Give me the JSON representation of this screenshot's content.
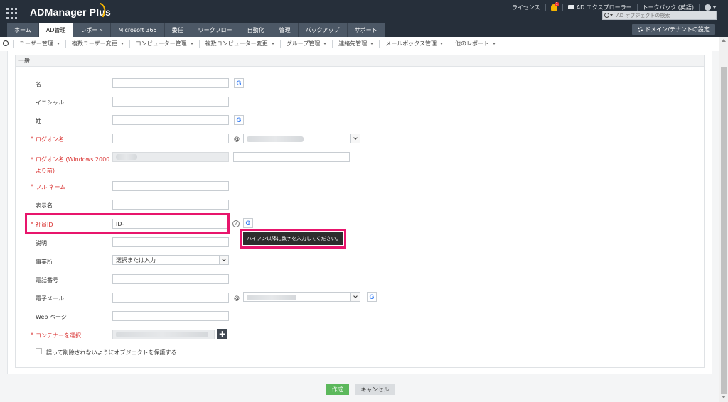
{
  "app": {
    "title": "ADManager Plus"
  },
  "top_links": {
    "license": "ライセンス",
    "notification_count": "1",
    "explorer": "AD エクスプローラー",
    "talkback": "トークバック (英語)"
  },
  "search": {
    "placeholder": "AD オブジェクトの検索"
  },
  "tabs": [
    {
      "label": "ホーム"
    },
    {
      "label": "AD管理",
      "active": true
    },
    {
      "label": "レポート"
    },
    {
      "label": "Microsoft 365"
    },
    {
      "label": "委任"
    },
    {
      "label": "ワークフロー"
    },
    {
      "label": "自動化"
    },
    {
      "label": "管理"
    },
    {
      "label": "バックアップ"
    },
    {
      "label": "サポート"
    }
  ],
  "domain_button": {
    "label": "ドメイン/テナントの設定"
  },
  "subnav": [
    "ユーザー管理",
    "複数ユーザー変更",
    "コンピューター管理",
    "複数コンピューター変更",
    "グループ管理",
    "連絡先管理",
    "メールボックス管理",
    "他のレポート"
  ],
  "section": {
    "title": "一般"
  },
  "form": {
    "first_name": {
      "label": "名"
    },
    "initials": {
      "label": "イニシャル"
    },
    "last_name": {
      "label": "姓"
    },
    "logon_name": {
      "label": "ログオン名",
      "at": "@"
    },
    "logon_name_pre2000": {
      "label_line1": "ログオン名 (Windows 2000",
      "label_line2": "より前)"
    },
    "full_name": {
      "label": "フル ネーム"
    },
    "display_name": {
      "label": "表示名"
    },
    "employee_id": {
      "label": "社員ID",
      "value": "ID-",
      "help": "?",
      "tooltip": "ハイフン以降に数字を入力してください。"
    },
    "description": {
      "label": "説明"
    },
    "office": {
      "label": "事業所",
      "value": "選択または入力"
    },
    "phone": {
      "label": "電話番号"
    },
    "email": {
      "label": "電子メール",
      "at": "@"
    },
    "web_page": {
      "label": "Web ページ"
    },
    "container": {
      "label": "コンテナーを選択"
    },
    "protect": {
      "label": "誤って削除されないようにオブジェクトを保護する"
    }
  },
  "google_icon": "G",
  "plus_icon": "+",
  "buttons": {
    "create": "作成",
    "cancel": "キャンセル"
  },
  "colors": {
    "topbar": "#262f3a",
    "tab": "#4c5866",
    "required": "#d9302f",
    "highlight": "#e8156c",
    "create_button": "#5cb85c"
  }
}
